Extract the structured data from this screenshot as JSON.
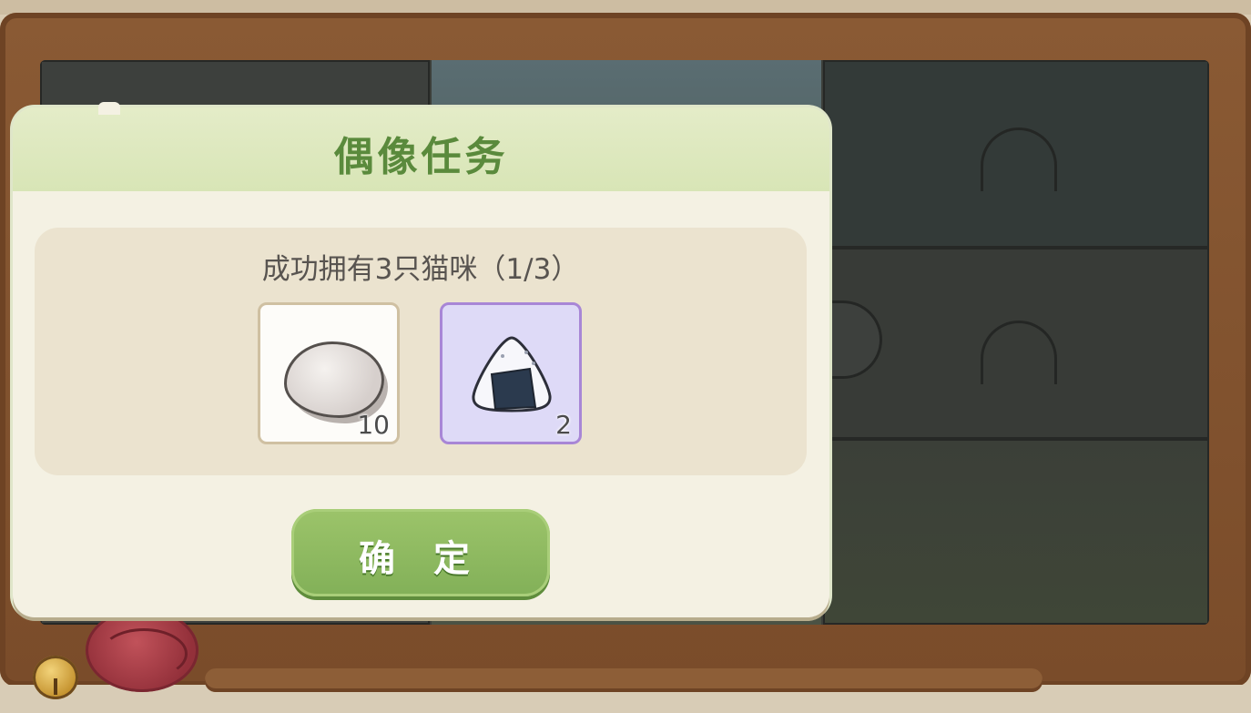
{
  "dialog": {
    "title": "偶像任务",
    "task_text": "成功拥有3只猫咪（1/3）",
    "rewards": [
      {
        "icon": "cotton-icon",
        "count": "10"
      },
      {
        "icon": "onigiri-icon",
        "count": "2"
      }
    ],
    "confirm_label": "确 定"
  },
  "colors": {
    "title_green": "#5a8a3c",
    "button_green": "#8cba60",
    "frame_wood": "#7a4c2a",
    "rare_purple": "#a886d6"
  }
}
